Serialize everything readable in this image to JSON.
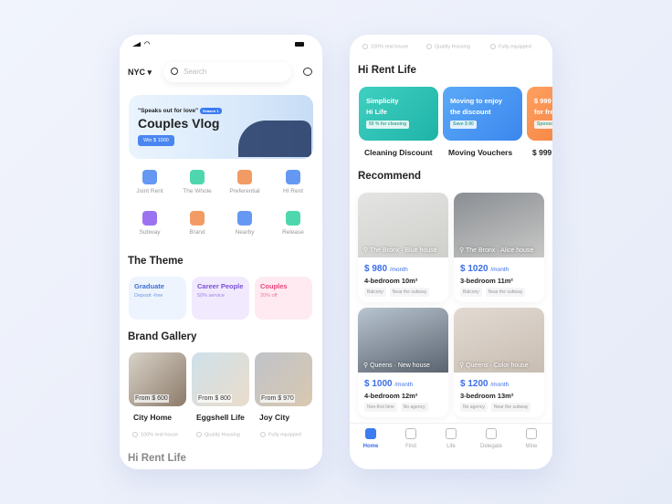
{
  "left": {
    "status": {
      "signal_icon": "signal-icon",
      "wifi_icon": "wifi-icon",
      "battery_icon": "battery-icon"
    },
    "city": "NYC",
    "search_placeholder": "Search",
    "message_icon": "message-icon",
    "banner": {
      "quote": "\"Speaks out for love\"",
      "badge": "Season 1",
      "title": "Couples Vlog",
      "button": "Win $ 1000"
    },
    "categories": [
      {
        "label": "Joint Rent",
        "color": "#4a86f0"
      },
      {
        "label": "The Whole",
        "color": "#2fd0a0"
      },
      {
        "label": "Preferential",
        "color": "#f08a4a"
      },
      {
        "label": "HI Rent",
        "color": "#4a86f0"
      },
      {
        "label": "Subway",
        "color": "#8a5af0"
      },
      {
        "label": "Brand",
        "color": "#f08a4a"
      },
      {
        "label": "Nearby",
        "color": "#4a86f0"
      },
      {
        "label": "Release",
        "color": "#2fd0a0"
      }
    ],
    "theme_title": "The Theme",
    "themes": [
      {
        "title": "Graduate",
        "sub": "Deposit -free",
        "color": "#3b6fd6"
      },
      {
        "title": "Career People",
        "sub": "50% service",
        "color": "#7a4fd6"
      },
      {
        "title": "Couples",
        "sub": "20% off",
        "color": "#e8457a"
      }
    ],
    "gallery_title": "Brand Gallery",
    "gallery": [
      {
        "price": "From $ 600",
        "name": "City Home"
      },
      {
        "price": "From $ 800",
        "name": "Eggshell Life"
      },
      {
        "price": "From $ 970",
        "name": "Joy City"
      }
    ],
    "features": [
      "100% real house",
      "Quality Housing",
      "Fully equipped"
    ],
    "next_title": "Hi Rent Life"
  },
  "right": {
    "features": [
      "100% real house",
      "Quality Housing",
      "Fully equipped"
    ],
    "life_title": "Hi Rent Life",
    "life": [
      {
        "line1": "Simplicity",
        "line2": "Hi Life",
        "tag": "50 % for cleaning",
        "label": "Cleaning Discount"
      },
      {
        "line1": "Moving to enjoy",
        "line2": "the discount",
        "tag": "Save $ 80",
        "label": "Moving Vouchers"
      },
      {
        "line1": "$ 999",
        "line2": "for free",
        "tag": "Sponsor",
        "label": "$ 999"
      }
    ],
    "recommend_title": "Recommend",
    "listings": [
      {
        "location": "The Bronx · Blue house",
        "price": "$ 980",
        "unit": "/month",
        "rooms": "4-bedroom 10m²",
        "tags": [
          "Balcony",
          "Near the subway"
        ]
      },
      {
        "location": "The Bronx · Alice house",
        "price": "$ 1020",
        "unit": "/month",
        "rooms": "3-bedroom 11m²",
        "tags": [
          "Balcony",
          "Near the subway"
        ]
      },
      {
        "location": "Queens · New house",
        "price": "$ 1000",
        "unit": "/month",
        "rooms": "4-bedroom 12m²",
        "tags": [
          "Non-first time",
          "No agency"
        ]
      },
      {
        "location": "Queens · Color house",
        "price": "$ 1200",
        "unit": "/month",
        "rooms": "3-bedroom 13m²",
        "tags": [
          "No agency",
          "Near the subway"
        ]
      }
    ],
    "tabs": [
      {
        "label": "Home",
        "active": true
      },
      {
        "label": "Find"
      },
      {
        "label": "Life"
      },
      {
        "label": "Delegate"
      },
      {
        "label": "Mine"
      }
    ]
  },
  "colors": {
    "accent": "#3c6ee8"
  }
}
